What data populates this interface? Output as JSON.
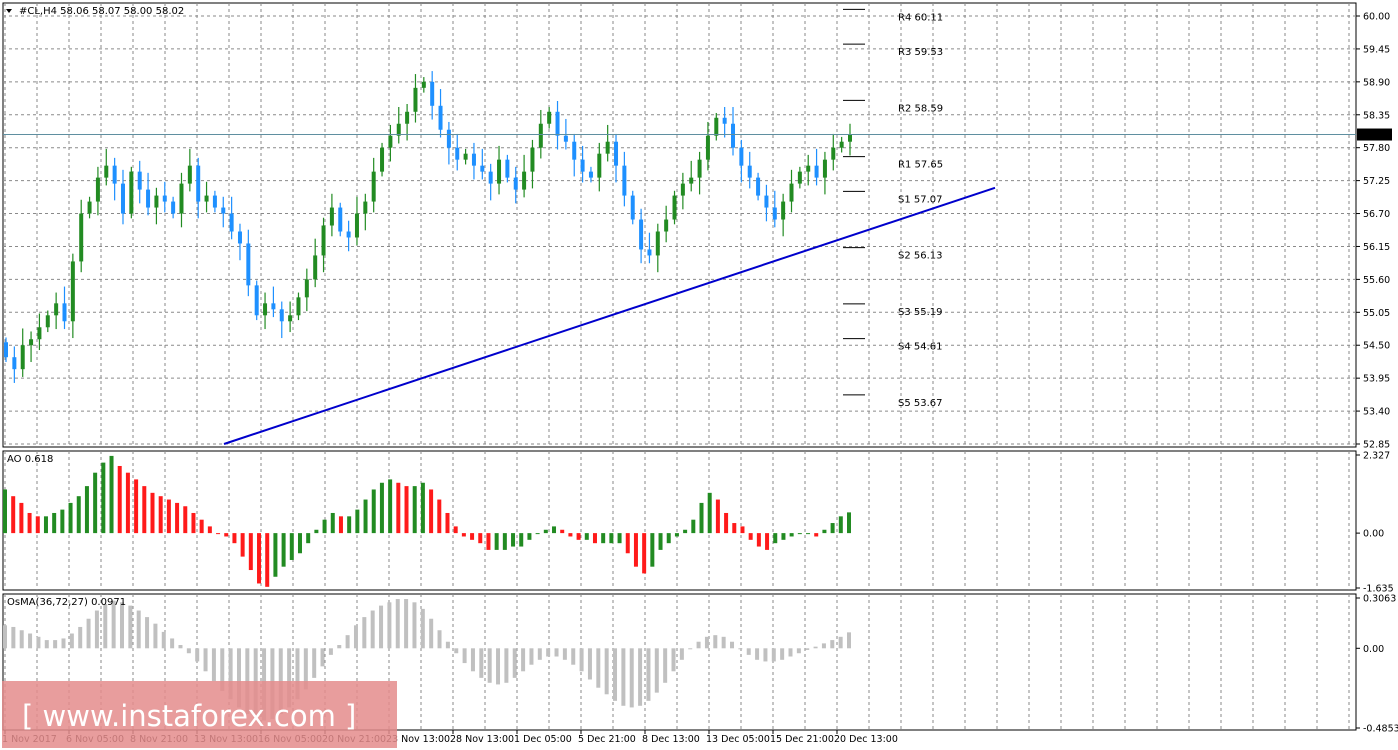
{
  "chart_data": {
    "type": "candlestick",
    "symbol_info": "#CL,H4  58.06 58.07 58.00 58.02",
    "current_price": "58.02",
    "price_axis": {
      "ylim": [
        52.85,
        60.0
      ],
      "ticks": [
        "60.00",
        "59.45",
        "58.90",
        "58.35",
        "57.80",
        "57.25",
        "56.70",
        "56.15",
        "55.60",
        "55.05",
        "54.50",
        "53.95",
        "53.40",
        "52.85"
      ]
    },
    "x_ticks": [
      "1 Nov 2017",
      "6 Nov 05:00",
      "8 Nov 21:00",
      "13 Nov 13:00",
      "16 Nov 05:00",
      "20 Nov 21:00",
      "23 Nov 13:00",
      "28 Nov 13:00",
      "1 Dec 05:00",
      "5 Dec 21:00",
      "8 Dec 13:00",
      "13 Dec 05:00",
      "15 Dec 21:00",
      "20 Dec 13:00"
    ],
    "pivot_levels": [
      {
        "label": "R4 60.11",
        "value": 60.11
      },
      {
        "label": "R3 59.53",
        "value": 59.53
      },
      {
        "label": "R2 58.59",
        "value": 58.59
      },
      {
        "label": "R1 57.65",
        "value": 57.65
      },
      {
        "label": "S1 57.07",
        "value": 57.07
      },
      {
        "label": "S2 56.13",
        "value": 56.13
      },
      {
        "label": "S3 55.19",
        "value": 55.19
      },
      {
        "label": "S4 54.61",
        "value": 54.61
      },
      {
        "label": "S5 53.67",
        "value": 53.67
      }
    ],
    "trendline": {
      "from": 52.85,
      "to": 57.13
    },
    "close_path": [
      54.3,
      54.1,
      54.5,
      54.6,
      54.8,
      55.0,
      55.2,
      54.9,
      55.9,
      56.7,
      56.9,
      57.3,
      57.5,
      57.2,
      56.7,
      57.4,
      57.1,
      56.8,
      57.0,
      56.9,
      56.7,
      57.2,
      57.5,
      56.9,
      57.0,
      56.8,
      56.7,
      56.4,
      56.2,
      55.5,
      55.0,
      55.2,
      55.1,
      54.9,
      55.0,
      55.3,
      55.6,
      56.0,
      56.5,
      56.8,
      56.4,
      56.3,
      56.7,
      56.9,
      57.4,
      57.8,
      58.0,
      58.2,
      58.4,
      58.8,
      58.9,
      58.5,
      58.1,
      57.8,
      57.6,
      57.7,
      57.5,
      57.4,
      57.2,
      57.6,
      57.3,
      57.1,
      57.4,
      57.8,
      58.2,
      58.4,
      58.0,
      57.9,
      57.6,
      57.4,
      57.3,
      57.7,
      57.9,
      57.5,
      57.0,
      56.6,
      56.1,
      56.0,
      56.4,
      56.6,
      57.0,
      57.2,
      57.3,
      57.6,
      58.0,
      58.3,
      58.2,
      57.8,
      57.5,
      57.3,
      57.0,
      56.8,
      56.6,
      56.9,
      57.2,
      57.4,
      57.5,
      57.3,
      57.6,
      57.8,
      57.9,
      58.02
    ],
    "ao": {
      "title": "AO 0.618",
      "ticks": [
        "2.327",
        "0.00",
        "-1.635"
      ],
      "ylim": [
        -1.635,
        2.327
      ],
      "values": [
        1.3,
        1.1,
        0.9,
        0.6,
        0.5,
        0.5,
        0.6,
        0.7,
        0.9,
        1.1,
        1.4,
        1.8,
        2.1,
        2.3,
        2.0,
        1.8,
        1.6,
        1.4,
        1.2,
        1.1,
        1.0,
        0.9,
        0.8,
        0.6,
        0.4,
        0.2,
        0.0,
        -0.1,
        -0.3,
        -0.7,
        -1.1,
        -1.5,
        -1.6,
        -1.3,
        -1.0,
        -0.8,
        -0.6,
        -0.3,
        0.1,
        0.4,
        0.6,
        0.5,
        0.5,
        0.7,
        1.0,
        1.3,
        1.5,
        1.6,
        1.5,
        1.4,
        1.4,
        1.5,
        1.3,
        1.0,
        0.6,
        0.2,
        -0.1,
        -0.2,
        -0.3,
        -0.5,
        -0.5,
        -0.5,
        -0.4,
        -0.4,
        -0.2,
        0.0,
        0.1,
        0.2,
        0.1,
        -0.1,
        -0.2,
        -0.2,
        -0.3,
        -0.3,
        -0.3,
        -0.3,
        -0.6,
        -1.0,
        -1.2,
        -1.0,
        -0.5,
        -0.3,
        -0.1,
        0.1,
        0.4,
        0.9,
        1.2,
        1.0,
        0.6,
        0.3,
        0.2,
        -0.2,
        -0.4,
        -0.5,
        -0.3,
        -0.2,
        -0.1,
        0.0,
        0.0,
        -0.1,
        0.1,
        0.3,
        0.5,
        0.618
      ]
    },
    "osma": {
      "title": "OsMA(36,72,27) 0.0971",
      "ticks": [
        "0.3063",
        "0.00",
        "-0.4853"
      ],
      "ylim": [
        -0.4853,
        0.3063
      ],
      "values": [
        0.14,
        0.13,
        0.11,
        0.09,
        0.07,
        0.05,
        0.05,
        0.06,
        0.09,
        0.13,
        0.18,
        0.23,
        0.27,
        0.29,
        0.28,
        0.26,
        0.23,
        0.19,
        0.15,
        0.1,
        0.06,
        0.02,
        -0.03,
        -0.08,
        -0.14,
        -0.2,
        -0.26,
        -0.31,
        -0.36,
        -0.4,
        -0.43,
        -0.44,
        -0.43,
        -0.4,
        -0.36,
        -0.31,
        -0.25,
        -0.18,
        -0.11,
        -0.04,
        0.02,
        0.08,
        0.14,
        0.19,
        0.23,
        0.26,
        0.28,
        0.3,
        0.3,
        0.28,
        0.24,
        0.18,
        0.11,
        0.04,
        -0.03,
        -0.09,
        -0.14,
        -0.18,
        -0.21,
        -0.22,
        -0.21,
        -0.18,
        -0.14,
        -0.1,
        -0.07,
        -0.05,
        -0.05,
        -0.07,
        -0.1,
        -0.14,
        -0.19,
        -0.24,
        -0.28,
        -0.32,
        -0.35,
        -0.36,
        -0.35,
        -0.32,
        -0.27,
        -0.21,
        -0.14,
        -0.07,
        0.0,
        0.04,
        0.07,
        0.08,
        0.07,
        0.04,
        0.0,
        -0.04,
        -0.07,
        -0.08,
        -0.08,
        -0.07,
        -0.05,
        -0.03,
        -0.01,
        0.01,
        0.03,
        0.05,
        0.07,
        0.0971
      ]
    },
    "colors": {
      "bull": "#228b22",
      "bear": "#1e90ff",
      "ao_up": "#228b22",
      "ao_down": "#ff1a1a",
      "osma": "#c0c0c0",
      "trendline": "#0000cc",
      "grid": "#8a8a8a",
      "price_line": "#5f8fa0"
    }
  },
  "watermark": {
    "text": "[ www.instaforex.com ]",
    "color": "#e48c8c"
  }
}
